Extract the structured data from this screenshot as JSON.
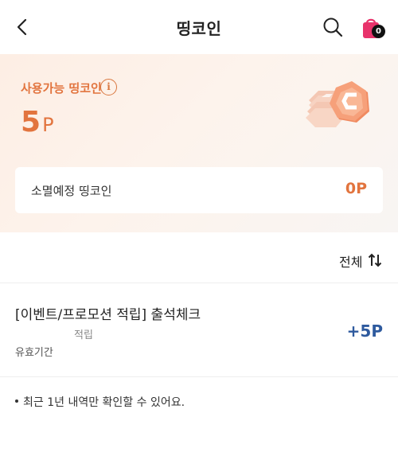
{
  "header": {
    "title": "띵코인",
    "cart_count": "0",
    "icons": {
      "back": "chevron-left-icon",
      "search": "search-icon",
      "cart": "shopping-bag-icon"
    }
  },
  "summary": {
    "available_label": "사용가능 띵코인",
    "info_symbol": "i",
    "points_value": "5",
    "points_unit": "P",
    "expiring_label": "소멸예정 띵코인",
    "expiring_value": "0P"
  },
  "list": {
    "filter_label": "전체",
    "items": [
      {
        "title": "[이벤트/프로모션 적립] 출석체크",
        "type": "적립",
        "validity_label": "유효기간",
        "amount": "+5P"
      }
    ]
  },
  "footer": {
    "note": "최근 1년 내역만 확인할 수 있어요."
  },
  "colors": {
    "accent": "#e2743e",
    "positive_amount": "#2e5a9e",
    "cart_icon": "#e8336b"
  }
}
